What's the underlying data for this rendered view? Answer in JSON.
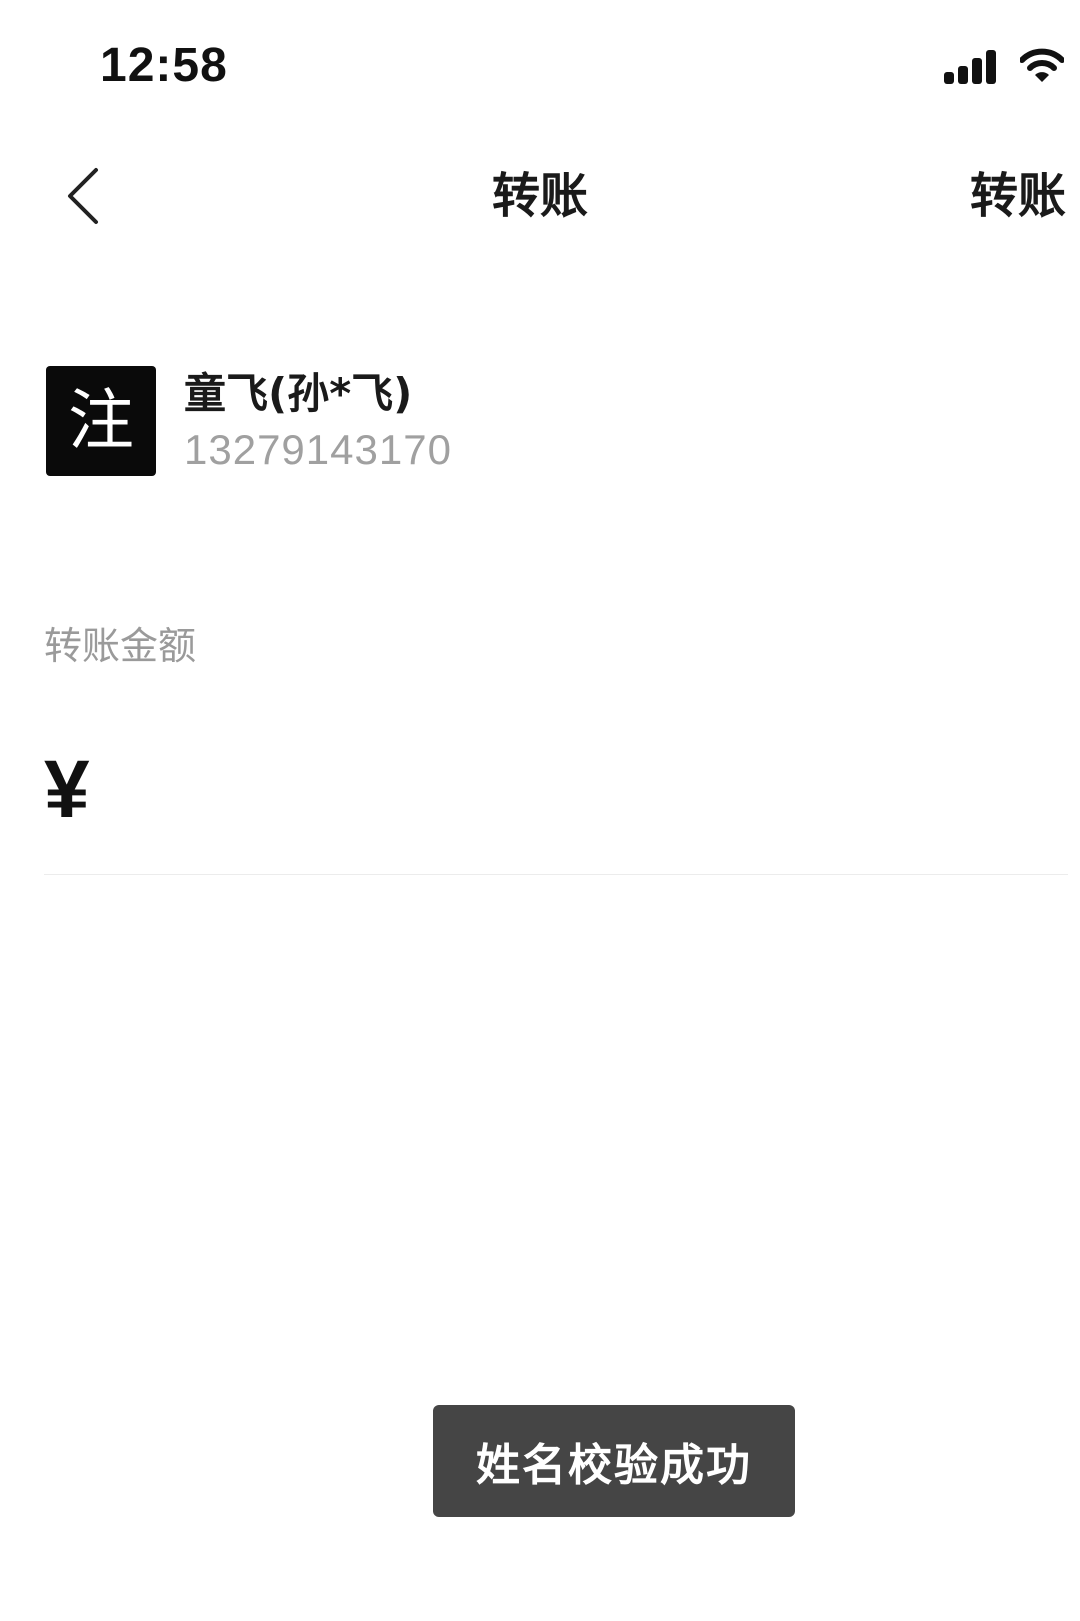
{
  "status_bar": {
    "time": "12:58",
    "icons": [
      "signal-icon",
      "wifi-icon"
    ]
  },
  "nav": {
    "back_icon": "chevron-left-icon",
    "title": "转账",
    "action_label": "转账"
  },
  "recipient": {
    "avatar_char": "注",
    "name": "童飞(孙*飞)",
    "phone": "13279143170"
  },
  "amount": {
    "label": "转账金额",
    "currency": "¥",
    "value": "",
    "placeholder": ""
  },
  "toast": {
    "text": "姓名校验成功"
  },
  "colors": {
    "background": "#ffffff",
    "text_primary": "#1a1a1a",
    "text_secondary": "#a0a0a0",
    "avatar_bg": "#0a0a0a",
    "toast_bg": "#454545",
    "divider": "#ececec"
  }
}
